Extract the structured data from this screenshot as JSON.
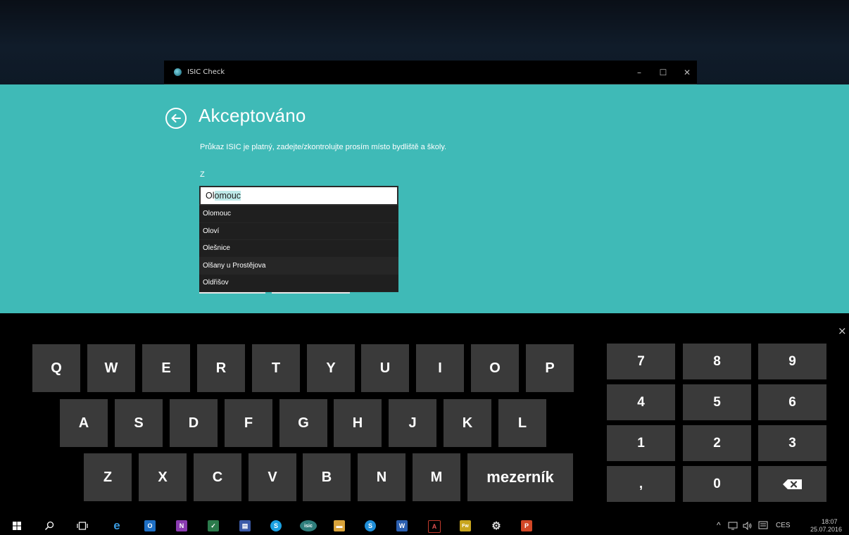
{
  "window": {
    "title": "ISIC Check",
    "minimize": "–",
    "maximize": "☐",
    "close": "✕"
  },
  "page": {
    "title": "Akceptováno",
    "subtitle": "Průkaz ISIC je platný, zadejte/zkontrolujte prosím místo bydliště a školy.",
    "field_label": "Z",
    "input_typed": "Ol",
    "input_autocomplete": "omouc"
  },
  "suggestions": [
    "Olomouc",
    "Oloví",
    "Olešnice",
    "Olšany u Prostějova",
    "Oldřišov"
  ],
  "keyboard": {
    "close": "×",
    "row1": [
      "Q",
      "W",
      "E",
      "R",
      "T",
      "Y",
      "U",
      "I",
      "O",
      "P"
    ],
    "row2": [
      "A",
      "S",
      "D",
      "F",
      "G",
      "H",
      "J",
      "K",
      "L"
    ],
    "row3": [
      "Z",
      "X",
      "C",
      "V",
      "B",
      "N",
      "M"
    ],
    "space": "mezerník",
    "numpad": [
      "7",
      "8",
      "9",
      "4",
      "5",
      "6",
      "1",
      "2",
      "3",
      ",",
      "0"
    ],
    "backspace_icon": "backspace-icon"
  },
  "taskbar": {
    "icons": [
      "windows-start-icon",
      "search-icon",
      "task-view-icon",
      "edge-icon",
      "outlook-icon",
      "onenote-icon",
      "project-icon",
      "save-icon",
      "skype-icon",
      "isic-icon",
      "file-explorer-icon",
      "skype-business-icon",
      "word-icon",
      "acrobat-icon",
      "fireworks-icon",
      "settings-icon",
      "powerpoint-icon"
    ],
    "isic_label": "isic",
    "tray_language": "CES",
    "time": "18:07",
    "date": "25.07.2016",
    "tray_arrow": "^"
  },
  "colors": {
    "accent": "#3fbab7",
    "key": "#3a3a3a",
    "keyboard_bg": "#000000"
  }
}
